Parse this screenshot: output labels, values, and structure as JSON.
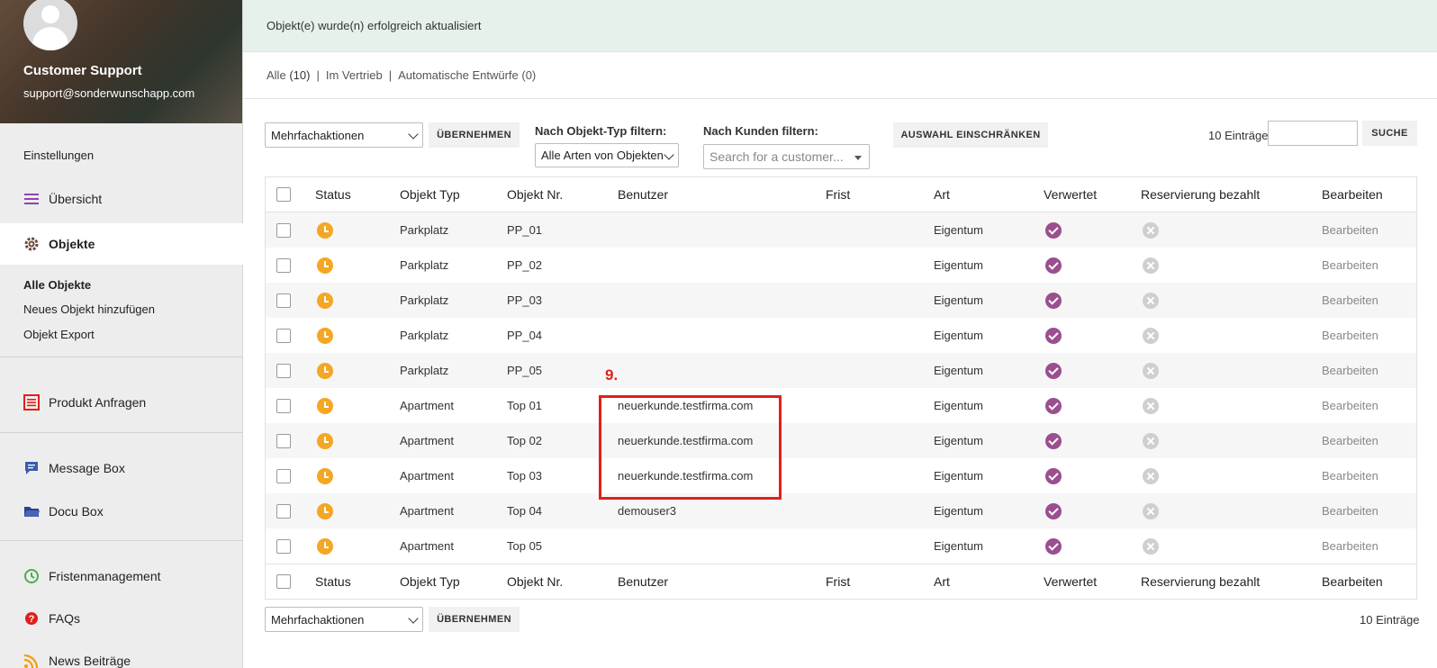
{
  "sidebar": {
    "profile_name": "Customer Support",
    "profile_email": "support@sonderwunschapp.com",
    "settings": "Einstellungen",
    "overview": "Übersicht",
    "objects": "Objekte",
    "sub_all": "Alle Objekte",
    "sub_new": "Neues Objekt hinzufügen",
    "sub_export": "Objekt Export",
    "product_requests": "Produkt Anfragen",
    "message_box": "Message Box",
    "docu_box": "Docu Box",
    "deadlines": "Fristenmanagement",
    "faqs": "FAQs",
    "news": "News Beiträge"
  },
  "notice": "Objekt(e) wurde(n) erfolgreich aktualisiert",
  "views": {
    "all_label": "Alle",
    "all_count": "(10)",
    "sep": "|",
    "sales": "Im Vertrieb",
    "drafts": "Automatische Entwürfe (0)"
  },
  "toolbar": {
    "bulk_actions": "Mehrfachaktionen",
    "apply": "ÜBERNEHMEN",
    "type_filter_label": "Nach Objekt-Typ filtern:",
    "type_filter_value": "Alle Arten von Objekten",
    "customer_filter_label": "Nach Kunden filtern:",
    "customer_placeholder": "Search for a customer...",
    "restrict": "AUSWAHL EINSCHRÄNKEN",
    "entries": "10 Einträge",
    "search": "SUCHE"
  },
  "columns": {
    "status": "Status",
    "type": "Objekt Typ",
    "number": "Objekt Nr.",
    "user": "Benutzer",
    "deadline": "Frist",
    "kind": "Art",
    "used": "Verwertet",
    "paid": "Reservierung bezahlt",
    "edit": "Bearbeiten"
  },
  "rows": [
    {
      "type": "Parkplatz",
      "number": "PP_01",
      "user": "",
      "kind": "Eigentum",
      "edit": "Bearbeiten"
    },
    {
      "type": "Parkplatz",
      "number": "PP_02",
      "user": "",
      "kind": "Eigentum",
      "edit": "Bearbeiten"
    },
    {
      "type": "Parkplatz",
      "number": "PP_03",
      "user": "",
      "kind": "Eigentum",
      "edit": "Bearbeiten"
    },
    {
      "type": "Parkplatz",
      "number": "PP_04",
      "user": "",
      "kind": "Eigentum",
      "edit": "Bearbeiten"
    },
    {
      "type": "Parkplatz",
      "number": "PP_05",
      "user": "",
      "kind": "Eigentum",
      "edit": "Bearbeiten"
    },
    {
      "type": "Apartment",
      "number": "Top 01",
      "user": "neuerkunde.testfirma.com",
      "kind": "Eigentum",
      "edit": "Bearbeiten"
    },
    {
      "type": "Apartment",
      "number": "Top 02",
      "user": "neuerkunde.testfirma.com",
      "kind": "Eigentum",
      "edit": "Bearbeiten"
    },
    {
      "type": "Apartment",
      "number": "Top 03",
      "user": "neuerkunde.testfirma.com",
      "kind": "Eigentum",
      "edit": "Bearbeiten"
    },
    {
      "type": "Apartment",
      "number": "Top 04",
      "user": "demouser3",
      "kind": "Eigentum",
      "edit": "Bearbeiten"
    },
    {
      "type": "Apartment",
      "number": "Top 05",
      "user": "",
      "kind": "Eigentum",
      "edit": "Bearbeiten"
    }
  ],
  "bottom": {
    "bulk_actions": "Mehrfachaktionen",
    "apply": "ÜBERNEHMEN",
    "entries": "10 Einträge"
  },
  "annotation": "9.",
  "icons": {
    "status": "clock-icon",
    "used": "check-circle-icon",
    "paid": "x-circle-icon"
  },
  "colors": {
    "status_pending": "#f5a623",
    "check": "#9b4f8f",
    "annotation": "#e0201b",
    "notice_bg": "#e6f2e9"
  }
}
